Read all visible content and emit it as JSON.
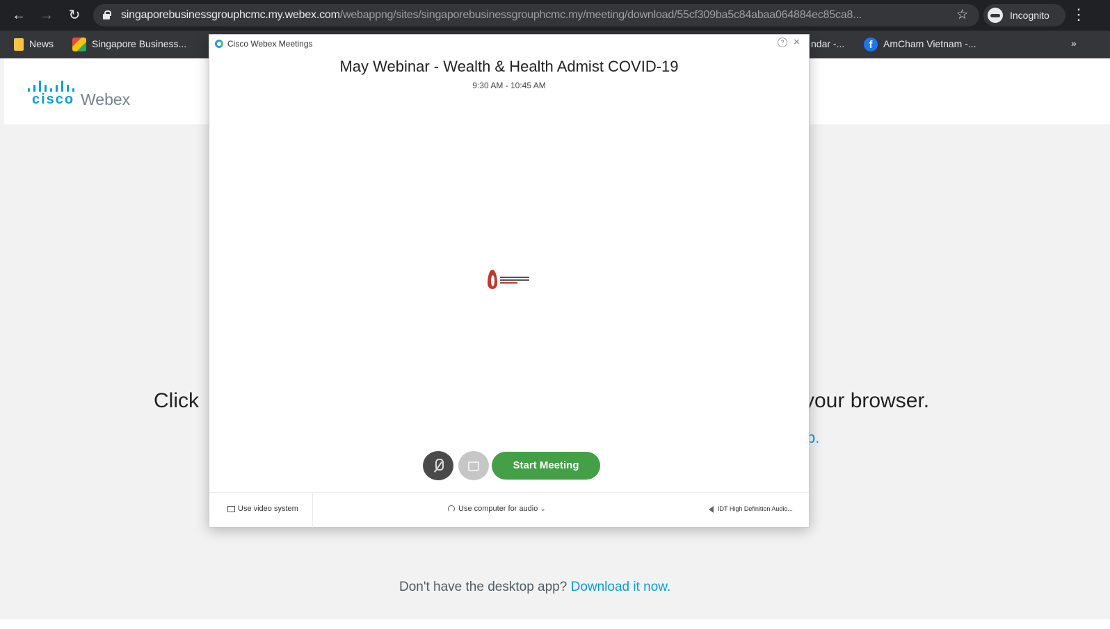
{
  "browser": {
    "url_host": "singaporebusinessgrouphcmc.my.webex.com",
    "url_path": "/webappng/sites/singaporebusinessgrouphcmc.my/meeting/download/55cf309ba5c84abaa064884ec85ca8...",
    "incognito_label": "Incognito",
    "bookmarks": [
      {
        "label": "News",
        "icon": "folder-icon"
      },
      {
        "label": "Singapore Business...",
        "icon": "sbg-icon"
      },
      {
        "label": "ndar -...",
        "icon": ""
      },
      {
        "label": "AmCham Vietnam -...",
        "icon": "facebook-icon"
      }
    ],
    "more_bookmarks": "»"
  },
  "page": {
    "brand_cisco": "cisco",
    "brand_webex": "Webex",
    "bg_text_left": "Click",
    "bg_text_right": "your browser.",
    "bg_link_fragment": "p.",
    "dont_have": "Don't have the desktop app?",
    "download_link": "Download it now."
  },
  "dialog": {
    "app_title": "Cisco Webex Meetings",
    "meeting_title": "May Webinar - Wealth & Health Admist COVID-19",
    "meeting_time": "9:30 AM - 10:45 AM",
    "start_button": "Start Meeting",
    "footer": {
      "video_system": "Use video system",
      "audio_option": "Use computer for audio",
      "speaker_device": "IDT High Definition Audio..."
    }
  },
  "colors": {
    "webex_blue": "#049fd9",
    "start_green": "#43a047",
    "chrome_dark": "#202124"
  }
}
